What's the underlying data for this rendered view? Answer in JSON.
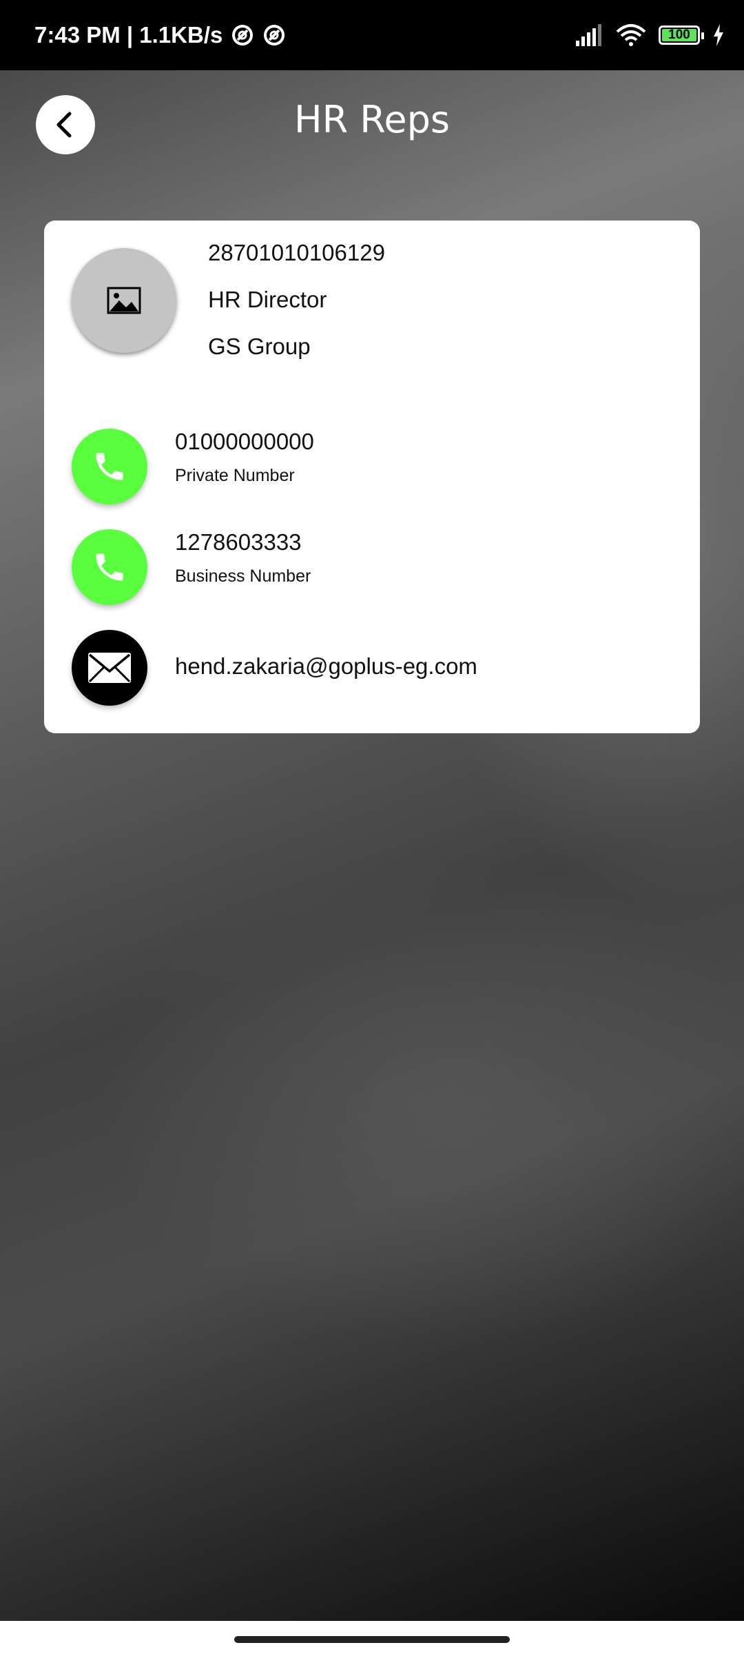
{
  "status_bar": {
    "time_speed": "7:43 PM | 1.1KB/s",
    "battery_level": "100"
  },
  "header": {
    "title": "HR Reps"
  },
  "card": {
    "id_number": "28701010106129",
    "job_title": "HR Director",
    "company": "GS Group",
    "contacts": [
      {
        "value": "01000000000",
        "label": "Private Number",
        "icon": "phone-icon"
      },
      {
        "value": "1278603333",
        "label": "Business Number",
        "icon": "phone-icon"
      },
      {
        "value": "hend.zakaria@goplus-eg.com",
        "icon": "mail-icon"
      }
    ]
  },
  "colors": {
    "phone_button": "#59ff3c",
    "mail_button": "#000000",
    "battery_fill": "#5de35a"
  }
}
